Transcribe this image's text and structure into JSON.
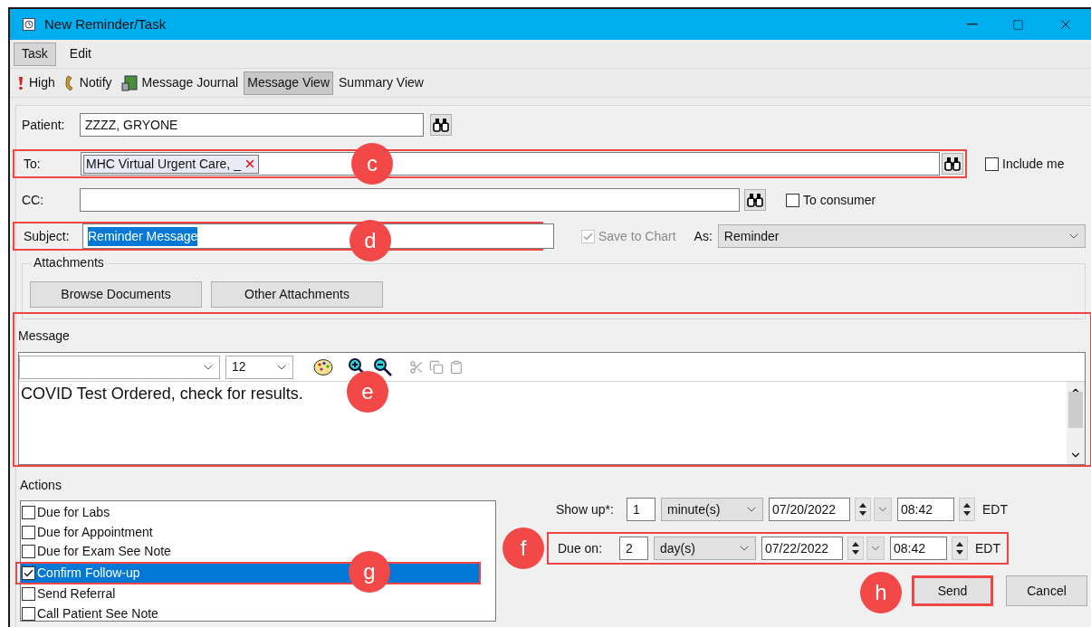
{
  "window": {
    "title": "New Reminder/Task"
  },
  "menu": [
    {
      "label": "Task",
      "selected": true
    },
    {
      "label": "Edit",
      "selected": false
    }
  ],
  "toolbar": [
    {
      "label": "High",
      "kind": "priority",
      "selected": false
    },
    {
      "label": "Notify",
      "kind": "phone",
      "selected": false
    },
    {
      "label": "Message Journal",
      "kind": "journal",
      "selected": false
    },
    {
      "label": "Message View",
      "kind": "text",
      "selected": true
    },
    {
      "label": "Summary View",
      "kind": "text",
      "selected": false
    }
  ],
  "patient": {
    "label": "Patient:",
    "value": "ZZZZ, GRYONE"
  },
  "to": {
    "label": "To:",
    "recipients": [
      "MHC Virtual Urgent Care, _"
    ],
    "callout": "c",
    "include_me": {
      "label": "Include me",
      "checked": false
    }
  },
  "cc": {
    "label": "CC:",
    "to_consumer": {
      "label": "To consumer",
      "checked": false
    }
  },
  "subject": {
    "label": "Subject:",
    "value": "Reminder Message",
    "callout": "d",
    "save_to_chart": {
      "label": "Save to Chart",
      "checked": true,
      "disabled": true
    },
    "as_label": "As:",
    "as_value": "Reminder"
  },
  "attachments": {
    "title": "Attachments",
    "buttons": [
      "Browse Documents",
      "Other Attachments"
    ]
  },
  "message": {
    "label": "Message",
    "font_size": "12",
    "text": "COVID Test Ordered, check for results.",
    "callout": "e"
  },
  "actions": {
    "title": "Actions",
    "items": [
      {
        "label": "Due for Labs",
        "checked": false,
        "selected": false
      },
      {
        "label": "Due for Appointment",
        "checked": false,
        "selected": false
      },
      {
        "label": "Due for Exam See Note",
        "checked": false,
        "selected": false
      },
      {
        "label": "Confirm Follow-up",
        "checked": true,
        "selected": true,
        "callout": "g"
      },
      {
        "label": "Send Referral",
        "checked": false,
        "selected": false
      },
      {
        "label": "Call Patient See Note",
        "checked": false,
        "selected": false
      }
    ]
  },
  "schedule": [
    {
      "label": "Show up*:",
      "count": "1",
      "unit": "minute(s)",
      "date": "07/20/2022",
      "time": "08:42",
      "zone": "EDT"
    },
    {
      "label": "Due on:",
      "count": "2",
      "unit": "day(s)",
      "date": "07/22/2022",
      "time": "08:42",
      "zone": "EDT",
      "callout": "f"
    }
  ],
  "buttons": [
    {
      "label": "Send",
      "callout": "h"
    },
    {
      "label": "Cancel"
    }
  ]
}
